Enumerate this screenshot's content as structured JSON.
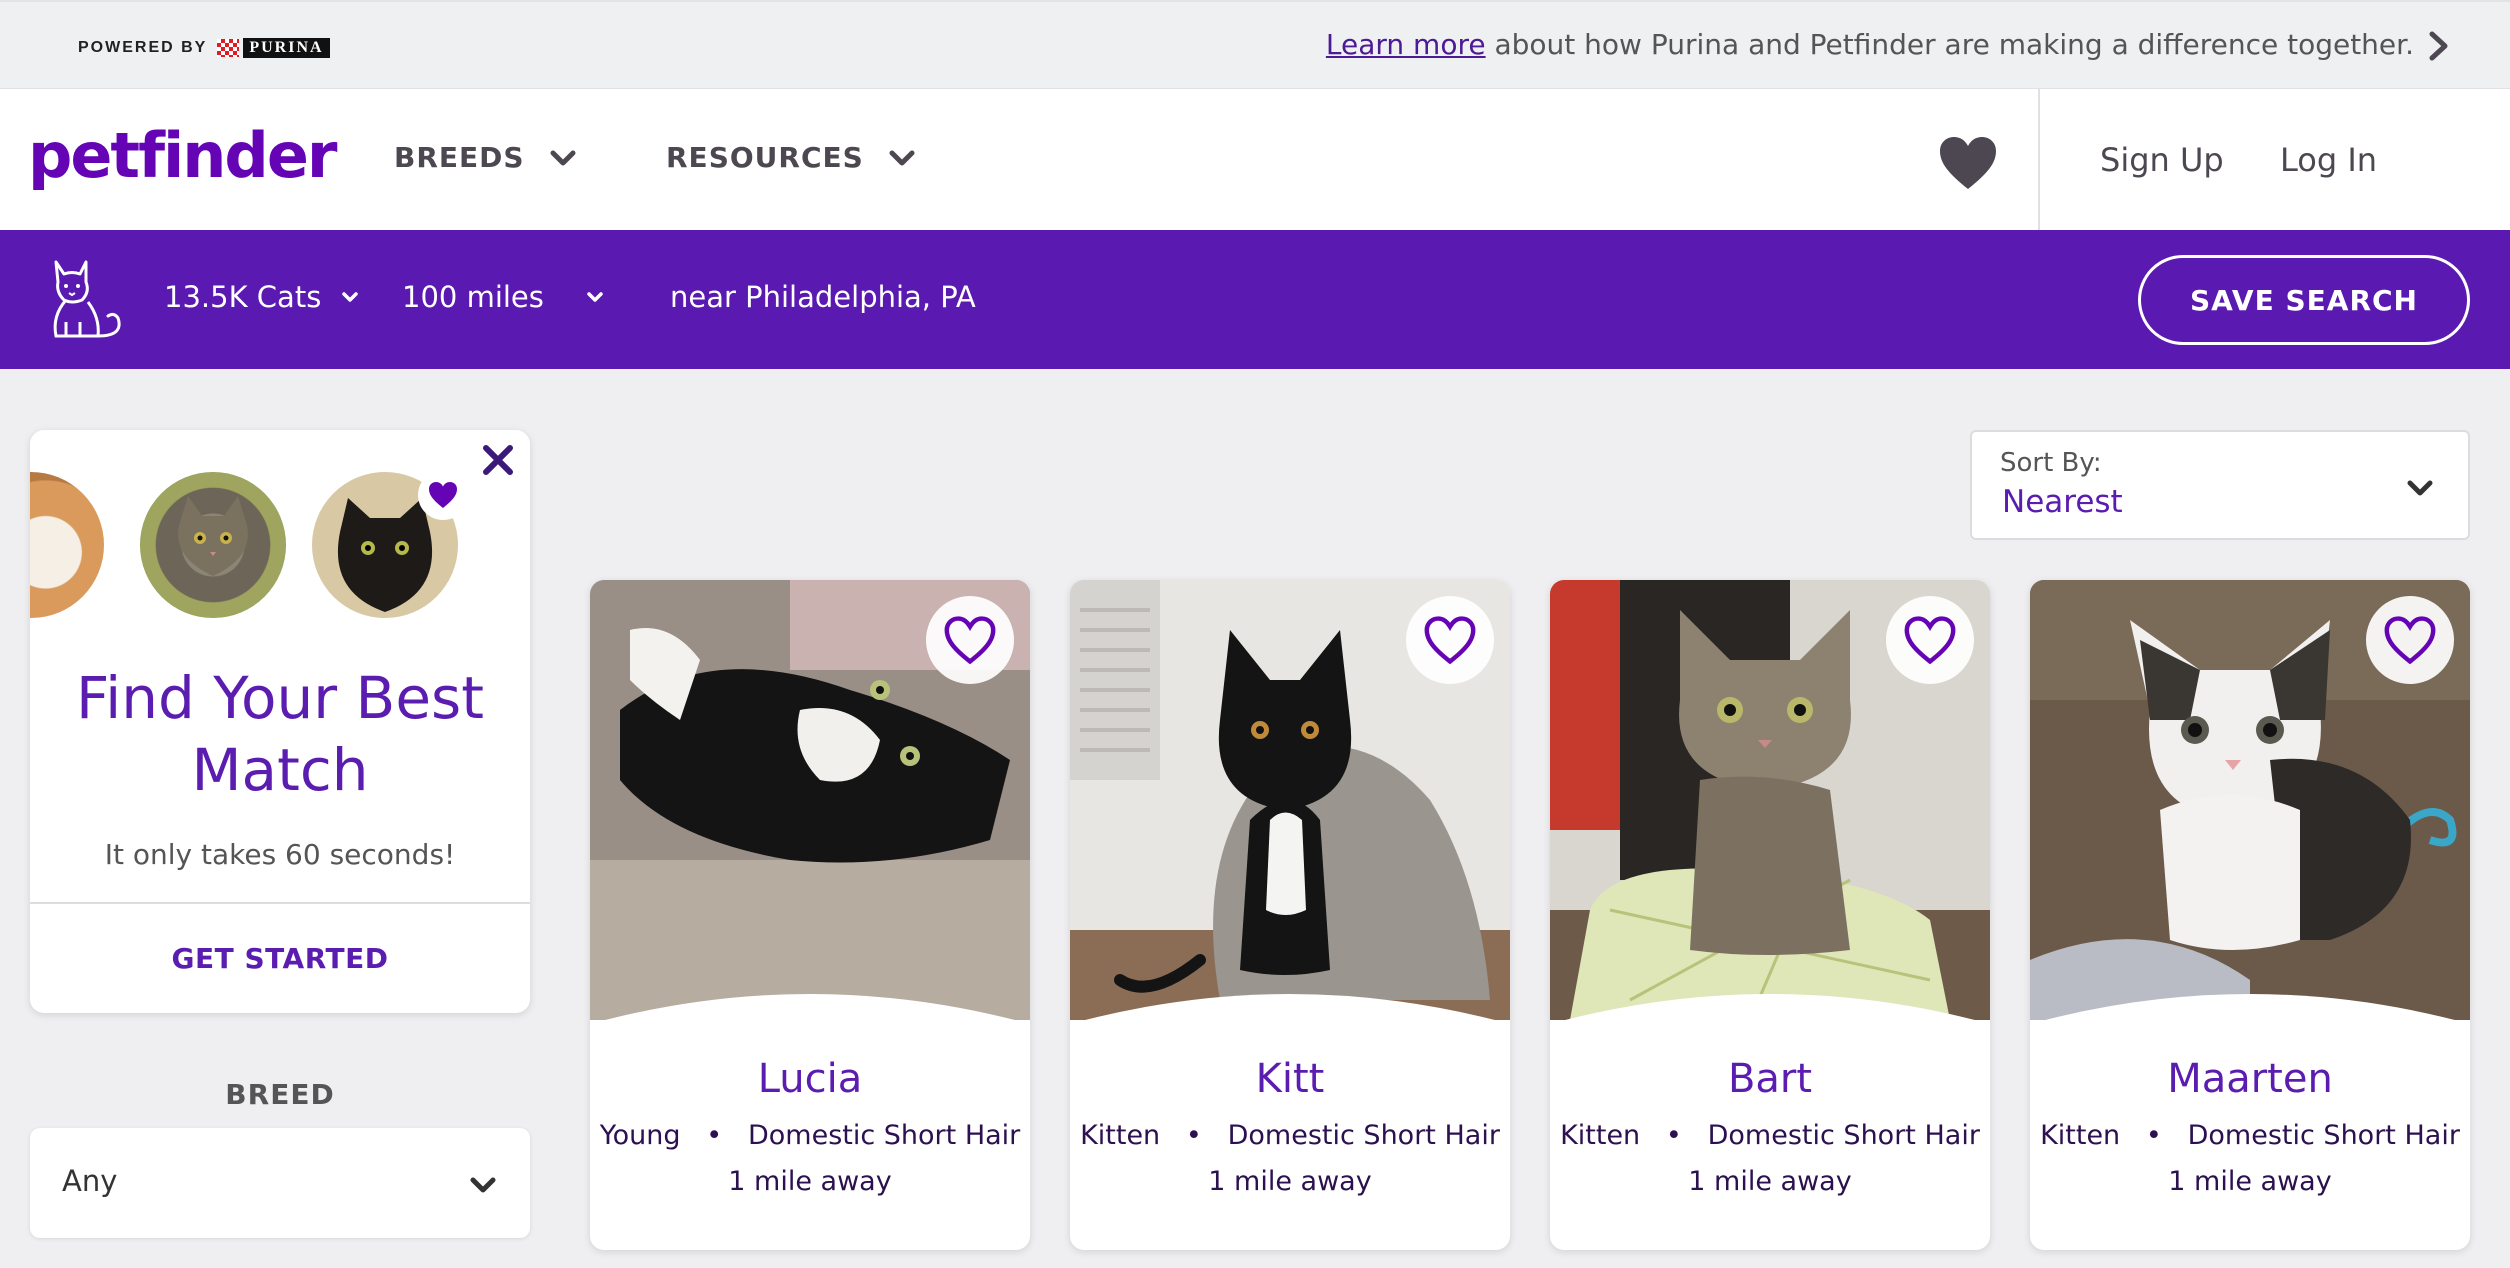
{
  "promo": {
    "powered_by": "POWERED BY",
    "brand": "PURINA",
    "link_text": "Learn more",
    "message": " about how Purina and Petfinder are making a difference together."
  },
  "header": {
    "logo": "petfinder",
    "nav": [
      {
        "label": "BREEDS"
      },
      {
        "label": "RESOURCES"
      }
    ],
    "sign_up": "Sign Up",
    "log_in": "Log In"
  },
  "search": {
    "count": "13.5K Cats",
    "distance": "100 miles",
    "location": "near Philadelphia, PA",
    "save_label": "SAVE SEARCH"
  },
  "match": {
    "title": "Find Your Best Match",
    "subtitle": "It only takes 60 seconds!",
    "cta": "GET STARTED"
  },
  "filters": {
    "breed_label": "BREED",
    "breed_value": "Any"
  },
  "sort": {
    "label": "Sort By:",
    "value": "Nearest"
  },
  "pets": [
    {
      "name": "Lucia",
      "age": "Young",
      "breed": "Domestic Short Hair",
      "distance": "1 mile away"
    },
    {
      "name": "Kitt",
      "age": "Kitten",
      "breed": "Domestic Short Hair",
      "distance": "1 mile away"
    },
    {
      "name": "Bart",
      "age": "Kitten",
      "breed": "Domestic Short Hair",
      "distance": "1 mile away"
    },
    {
      "name": "Maarten",
      "age": "Kitten",
      "breed": "Domestic Short Hair",
      "distance": "1 mile away"
    }
  ],
  "colors": {
    "brand_purple": "#5a19b1",
    "accent_purple": "#6504b5"
  }
}
